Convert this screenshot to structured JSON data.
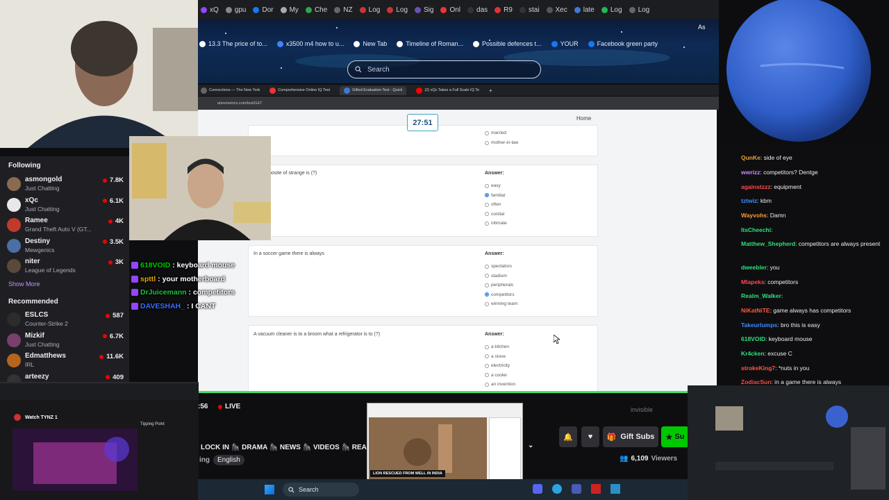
{
  "browser_tabs": [
    "xQ",
    "gpu",
    "Dor",
    "My",
    "Che",
    "NZ",
    "Log",
    "Log",
    "Sig",
    "Onl",
    "das",
    "R9",
    "stai",
    "Xec",
    "late",
    "Log",
    "Log"
  ],
  "bookmarks": [
    "13.3 The price of to...",
    "x3500 m4 how to u...",
    "New Tab",
    "Timeline of Roman...",
    "Possible defences t...",
    "YOUR",
    "Facebook green party"
  ],
  "bookmark_extra": "As",
  "search": {
    "placeholder": "Search"
  },
  "inner_tabs": [
    {
      "label": "Connections — The New York"
    },
    {
      "label": "Comprehensive Online IQ Test"
    },
    {
      "label": "Gifted Evaluation Test - Quick"
    },
    {
      "label": "(2) xQc Takes a Full Scale IQ Te"
    }
  ],
  "inner_address": "ativemetrics.com/test/GET",
  "page": {
    "timer": "27:51",
    "home_link": "Home",
    "q0": {
      "options": [
        "married",
        "mother-in-law"
      ]
    },
    "q1": {
      "text": "posite of strange is (?)",
      "answer_label": "Answer:",
      "options": [
        "easy",
        "familiar",
        "often",
        "cordial",
        "intimate"
      ],
      "selected": 1
    },
    "q2": {
      "text": "In a soccer game there is always",
      "answer_label": "Answer:",
      "options": [
        "spectators",
        "stadium",
        "peripherals",
        "competitors",
        "winning team"
      ],
      "selected": 3
    },
    "q3": {
      "text": "A vacuum cleaner is to a broom what a refrigerator is to (?)",
      "answer_label": "Answer:",
      "options": [
        "a kitchen",
        "a stove",
        "electricity",
        "a cooler",
        "an invention"
      ],
      "selected": -1
    }
  },
  "sidebar": {
    "following_header": "Following",
    "following": [
      {
        "name": "asmongold",
        "game": "Just Chatting",
        "viewers": "7.8K",
        "color": "#8a6b52"
      },
      {
        "name": "xQc",
        "game": "Just Chatting",
        "viewers": "6.1K",
        "color": "#e8e8e8"
      },
      {
        "name": "Ramee",
        "game": "Grand Theft Auto V (GT...",
        "viewers": "4K",
        "color": "#c0392b"
      },
      {
        "name": "Destiny",
        "game": "Mewgenics",
        "viewers": "3.5K",
        "color": "#4a6fa5"
      },
      {
        "name": "niter",
        "game": "League of Legends",
        "viewers": "3K",
        "color": "#5a4a3a"
      }
    ],
    "show_more": "Show More",
    "recommended_header": "Recommended",
    "recommended": [
      {
        "name": "ESLCS",
        "game": "Counter-Strike 2",
        "viewers": "587",
        "color": "#2c2c2c"
      },
      {
        "name": "Mizkif",
        "game": "Just Chatting",
        "viewers": "6.7K",
        "color": "#7a3f6b"
      },
      {
        "name": "Edmatthews",
        "game": "IRL",
        "viewers": "11.6K",
        "color": "#b5651d"
      },
      {
        "name": "arteezy",
        "game": "",
        "viewers": "409",
        "color": "#333"
      }
    ]
  },
  "overlay_chat": [
    {
      "user": "618VOID",
      "text": ": keyboard mouse",
      "color": "#00c800"
    },
    {
      "user": "spttl",
      "text": ": your motherboard",
      "color": "#e6a100"
    },
    {
      "user": "DrJuicemann",
      "text": ": competitors",
      "color": "#1fbf3f"
    },
    {
      "user": "DAVESHAH_",
      "text": ": I CANT",
      "color": "#3a6cff"
    }
  ],
  "chat": [
    {
      "user": "QunKe",
      "text": ": side of eye",
      "color": "#e8a33d"
    },
    {
      "user": "wwrizz",
      "text": ": competitors? Dentge",
      "color": "#c98aff"
    },
    {
      "user": "againstzzz",
      "text": ": equipment",
      "color": "#ff4a4a"
    },
    {
      "user": "tztwiz",
      "text": ": kbm",
      "color": "#3c8cff"
    },
    {
      "user": "Wayvohs",
      "text": ": Damn",
      "color": "#ff9a3c"
    },
    {
      "user": "ItsCheechi",
      "text": ":",
      "color": "#2ee07a"
    },
    {
      "user": "Matthew_Shepherd",
      "text": ": competitors are always present",
      "color": "#2ee07a"
    },
    {
      "user": "dweebler",
      "text": ": you",
      "color": "#2ee07a"
    },
    {
      "user": "Mlapeks",
      "text": ": competitors",
      "color": "#ff4a4a"
    },
    {
      "user": "Realm_Walker",
      "text": ":",
      "color": "#2ee07a"
    },
    {
      "user": "NiKatNiTE",
      "text": ": game always has competitors",
      "color": "#ff5a3c"
    },
    {
      "user": "Takeurlumps",
      "text": ": bro this is easy",
      "color": "#3c8cff"
    },
    {
      "user": "618VOID",
      "text": ": keyboard mouse",
      "color": "#2ee07a"
    },
    {
      "user": "Kr4cken",
      "text": ": excuse C",
      "color": "#2ee07a"
    },
    {
      "user": "strokeKing7",
      "text": ": *nuts in you",
      "color": "#ff5a3c"
    },
    {
      "user": "ZodiacSun",
      "text": ": in a game there is always",
      "color": "#ff4a4a"
    }
  ],
  "stream_bar": {
    "time": ":56",
    "live": "LIVE",
    "tags": "LOCK IN 🦍 DRAMA 🦍 NEWS 🦍 VIDEOS 🦍 REACTS 🦍",
    "lang_prefix": "ing",
    "language": "English",
    "gift_subs": "Gift Subs",
    "subscribe": "Su",
    "viewers": "6,109",
    "viewers_label": "Viewers",
    "invisible": "invisible"
  },
  "preview": {
    "title": "Watch TYNZ 1",
    "caption": "Tipping Point"
  },
  "popup": {
    "caption": "LION RESCUED FROM WELL IN INDIA"
  },
  "taskbar": {
    "search": "Search"
  }
}
